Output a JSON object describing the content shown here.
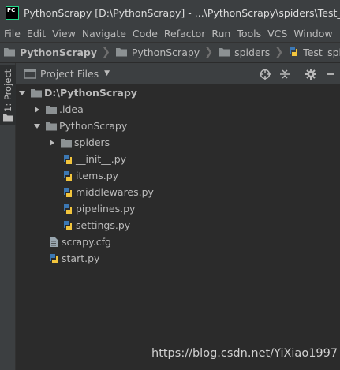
{
  "window": {
    "app_logo": "PC",
    "title": "PythonScrapy [D:\\PythonScrapy] - ...\\PythonScrapy\\spiders\\Test_spider.py"
  },
  "menu": [
    "File",
    "Edit",
    "View",
    "Navigate",
    "Code",
    "Refactor",
    "Run",
    "Tools",
    "VCS",
    "Window"
  ],
  "breadcrumb": [
    {
      "label": "PythonScrapy",
      "icon": "folder-icon"
    },
    {
      "label": "PythonScrapy",
      "icon": "folder-icon"
    },
    {
      "label": "spiders",
      "icon": "folder-icon"
    },
    {
      "label": "Test_spider.py",
      "icon": "python-file-icon"
    }
  ],
  "toolstrip": {
    "project_tab": "1: Project"
  },
  "panel": {
    "title": "Project Files",
    "tools": [
      "locate-icon",
      "collapse-all-icon",
      "gear-icon",
      "hide-icon"
    ]
  },
  "tree": [
    {
      "label": "D:\\PythonScrapy",
      "type": "folder",
      "expanded": true
    },
    {
      "label": ".idea",
      "type": "folder",
      "expanded": false
    },
    {
      "label": "PythonScrapy",
      "type": "folder",
      "expanded": true
    },
    {
      "label": "spiders",
      "type": "folder",
      "expanded": false
    },
    {
      "label": "__init__.py",
      "type": "python"
    },
    {
      "label": "items.py",
      "type": "python"
    },
    {
      "label": "middlewares.py",
      "type": "python"
    },
    {
      "label": "pipelines.py",
      "type": "python"
    },
    {
      "label": "settings.py",
      "type": "python"
    },
    {
      "label": "scrapy.cfg",
      "type": "cfg"
    },
    {
      "label": "start.py",
      "type": "python"
    }
  ],
  "watermark": "https://blog.csdn.net/YiXiao1997",
  "colors": {
    "background": "#2b2b2b",
    "chrome": "#3c3f41",
    "text": "#bbbbbb",
    "folder": "#8c9193",
    "python_blue": "#3c78b4",
    "python_yellow": "#f2c53d"
  }
}
